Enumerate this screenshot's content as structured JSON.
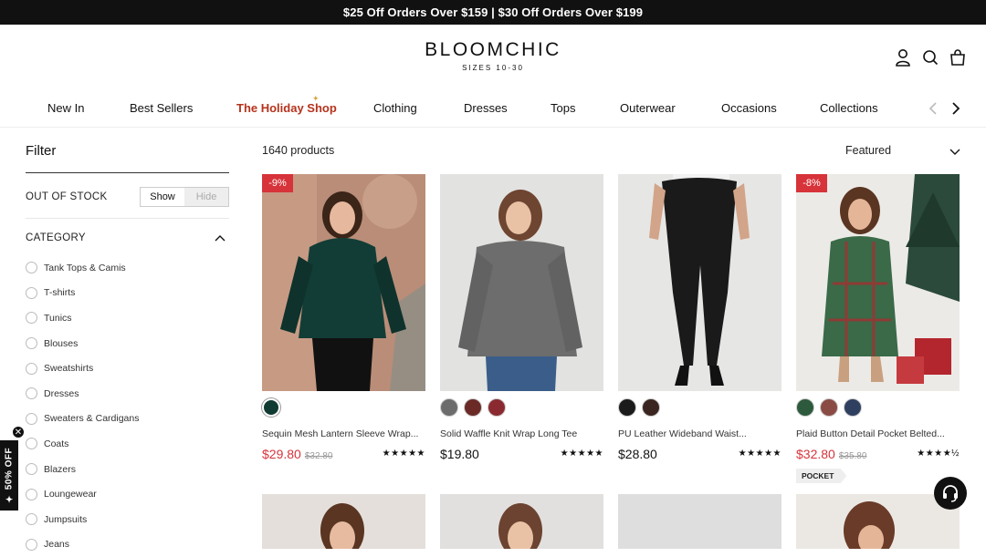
{
  "promo": "$25 Off Orders Over $159  |  $30 Off Orders Over $199",
  "logo": {
    "name": "BLOOMCHIC",
    "tagline": "SIZES 10-30"
  },
  "nav": [
    "New In",
    "Best Sellers",
    "The Holiday Shop",
    "Clothing",
    "Dresses",
    "Tops",
    "Outerwear",
    "Occasions",
    "Collections"
  ],
  "filter": {
    "title": "Filter",
    "out_of_stock": {
      "label": "OUT OF STOCK",
      "show": "Show",
      "hide": "Hide"
    },
    "category": {
      "label": "CATEGORY",
      "items": [
        "Tank Tops & Camis",
        "T-shirts",
        "Tunics",
        "Blouses",
        "Sweatshirts",
        "Dresses",
        "Sweaters & Cardigans",
        "Coats",
        "Blazers",
        "Loungewear",
        "Jumpsuits",
        "Jeans"
      ]
    }
  },
  "side_promo": "✦ 50% OFF",
  "products_count": "1640 products",
  "sort": "Featured",
  "products": [
    {
      "title": "Sequin Mesh Lantern Sleeve Wrap...",
      "price": "$29.80",
      "old": "$32.80",
      "badge": "-9%",
      "sale": true,
      "rating": "★★★★★",
      "swatches": [
        "#0f3b33"
      ]
    },
    {
      "title": "Solid Waffle Knit Wrap Long Tee",
      "price": "$19.80",
      "old": "",
      "badge": "",
      "sale": false,
      "rating": "★★★★★",
      "swatches": [
        "#6c6c6c",
        "#6b2a26",
        "#8a2a30"
      ]
    },
    {
      "title": "PU Leather Wideband Waist...",
      "price": "$28.80",
      "old": "",
      "badge": "",
      "sale": false,
      "rating": "★★★★★",
      "swatches": [
        "#1b1b1b",
        "#3b2520"
      ]
    },
    {
      "title": "Plaid Button Detail Pocket Belted...",
      "price": "$32.80",
      "old": "$35.80",
      "badge": "-8%",
      "sale": true,
      "rating": "★★★★½",
      "tag": "POCKET",
      "swatches": [
        "#2d5a3c",
        "#8b4b45",
        "#2f3f60"
      ]
    }
  ]
}
